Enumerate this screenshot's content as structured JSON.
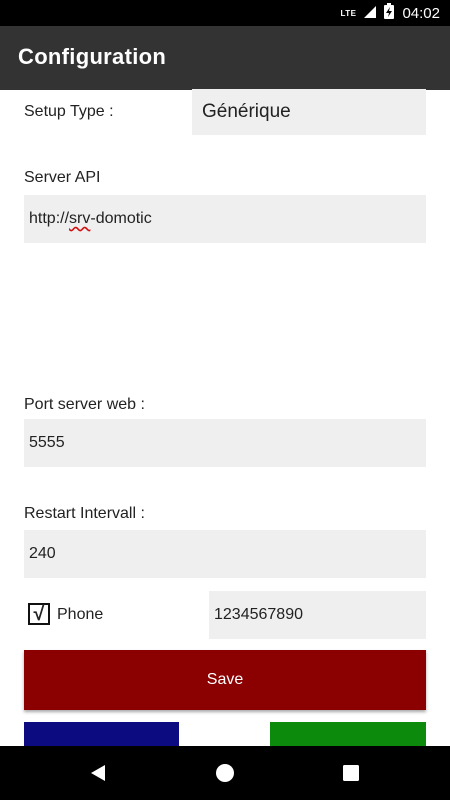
{
  "status_bar": {
    "network": "LTE",
    "time": "04:02"
  },
  "app_bar": {
    "title": "Configuration"
  },
  "form": {
    "setup_type": {
      "label": "Setup Type :",
      "selected": "Générique"
    },
    "server_api": {
      "label": "Server API",
      "prefix": "http://",
      "misspelled": "srv",
      "suffix": "-domotic"
    },
    "port_server_web": {
      "label": "Port server web :",
      "value": "5555"
    },
    "restart_interval": {
      "label": "Restart Intervall :",
      "value": "240"
    },
    "phone": {
      "checkbox_mark": "√",
      "label": "Phone",
      "value": "1234567890",
      "checked": true
    }
  },
  "buttons": {
    "save": "Save"
  },
  "colors": {
    "save": "#8b0000",
    "left_button": "#0c0c80",
    "right_button": "#0b8a0b",
    "app_bar": "#333333"
  },
  "nav_bar": {
    "icons": [
      "back-icon",
      "home-icon",
      "recent-apps-icon"
    ]
  }
}
